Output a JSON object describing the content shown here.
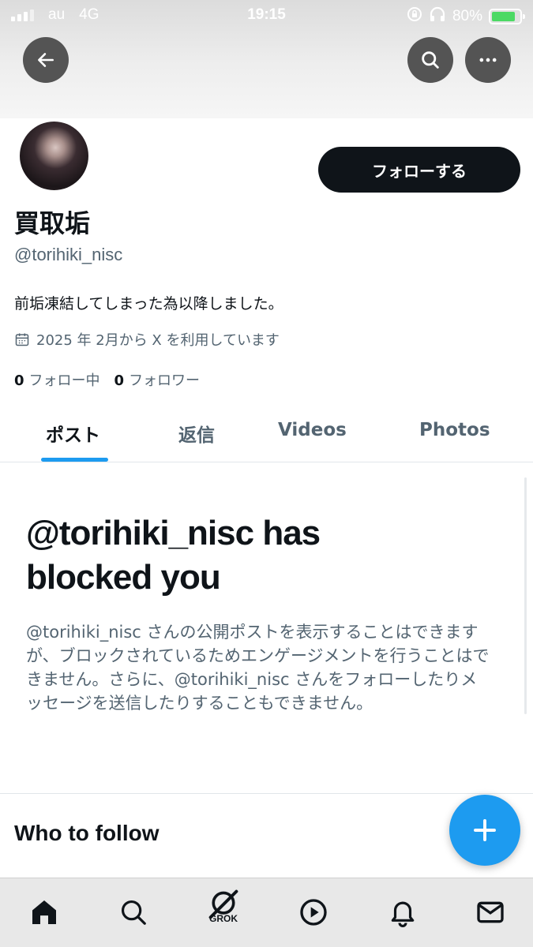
{
  "status_bar": {
    "carrier": "au",
    "network": "4G",
    "time": "19:15",
    "battery": "80%",
    "icons": [
      "signal-icon",
      "orientation-lock-icon",
      "headphones-icon",
      "battery-charging-icon"
    ]
  },
  "header": {
    "icons": [
      "back-arrow-icon",
      "search-icon",
      "more-icon"
    ]
  },
  "profile": {
    "display_name": "買取垢",
    "handle": "@torihiki_nisc",
    "bio": "前垢凍結してしまった為以降しました。",
    "joined": "2025 年 2月から X を利用しています",
    "follow_button": "フォローする",
    "following_count": "0",
    "following_label": "フォロー中",
    "followers_count": "0",
    "followers_label": "フォロワー"
  },
  "tabs": [
    {
      "label": "ポスト",
      "active": true
    },
    {
      "label": "返信",
      "active": false
    },
    {
      "label": "Videos",
      "active": false
    },
    {
      "label": "Photos",
      "active": false
    }
  ],
  "blocked": {
    "title": "@torihiki_nisc has blocked you",
    "body": "@torihiki_nisc さんの公開ポストを表示することはできますが、ブロックされているためエンゲージメントを行うことはできません。さらに、@torihiki_nisc さんをフォローしたりメッセージを送信したりすることもできません。"
  },
  "who_to_follow": {
    "title": "Who to follow"
  },
  "bottom_nav": {
    "items": [
      "home-icon",
      "search-icon",
      "grok-icon",
      "video-icon",
      "notifications-icon",
      "messages-icon"
    ],
    "grok_label": "GROK"
  },
  "colors": {
    "accent": "#1d9bf0",
    "text_primary": "#0f1419",
    "text_secondary": "#536471",
    "button_dark": "#0f1419"
  }
}
